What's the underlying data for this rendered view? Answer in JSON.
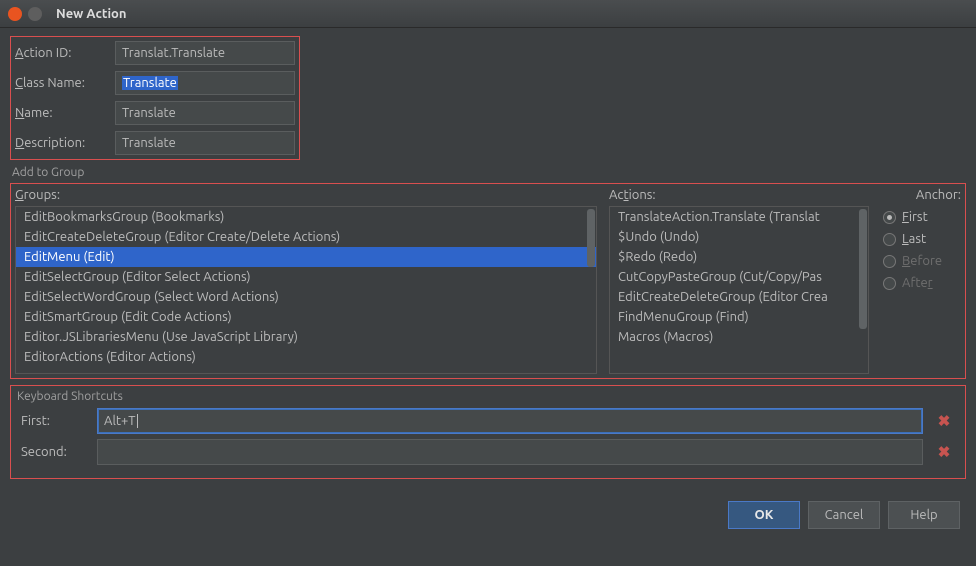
{
  "window": {
    "title": "New Action"
  },
  "form": {
    "action_id": {
      "label_pre": "A",
      "label_post": "ction ID:",
      "value": "Translat.Translate"
    },
    "class_name": {
      "label_pre": "C",
      "label_post": "lass Name:",
      "value": "Translate"
    },
    "name": {
      "label_pre": "N",
      "label_post": "ame:",
      "value": "Translate"
    },
    "description": {
      "label_pre": "D",
      "label_post": "escription:",
      "value": "Translate"
    }
  },
  "add_to_group_label": "Add to Group",
  "groups": {
    "label_pre": "G",
    "label_post": "roups:",
    "items": [
      "EditBookmarksGroup (Bookmarks)",
      "EditCreateDeleteGroup (Editor Create/Delete Actions)",
      "EditMenu (Edit)",
      "EditSelectGroup (Editor Select Actions)",
      "EditSelectWordGroup (Select Word Actions)",
      "EditSmartGroup (Edit Code Actions)",
      "Editor.JSLibrariesMenu (Use JavaScript Library)",
      "EditorActions (Editor Actions)"
    ],
    "selected_index": 2
  },
  "actions": {
    "label_pre": "Ac",
    "label_ul": "t",
    "label_post": "ions:",
    "items": [
      "TranslateAction.Translate (Translat",
      "$Undo (Undo)",
      "$Redo (Redo)",
      "CutCopyPasteGroup (Cut/Copy/Pas",
      "EditCreateDeleteGroup (Editor Crea",
      "FindMenuGroup (Find)",
      "Macros (Macros)"
    ]
  },
  "anchor": {
    "label": "Anchor:",
    "options": [
      {
        "ul": "F",
        "rest": "irst",
        "checked": true,
        "disabled": false
      },
      {
        "ul": "L",
        "rest": "ast",
        "checked": false,
        "disabled": false
      },
      {
        "ul": "B",
        "rest": "efore",
        "checked": false,
        "disabled": true
      },
      {
        "ul": "",
        "rest": "After",
        "checked": false,
        "disabled": true,
        "ul_mid": "r",
        "pre": "Afte"
      }
    ]
  },
  "keyboard": {
    "legend": "Keyboard Shortcuts",
    "first": {
      "label": "First:",
      "value": "Alt+T"
    },
    "second": {
      "label": "Second:",
      "value": ""
    }
  },
  "buttons": {
    "ok": "OK",
    "cancel": "Cancel",
    "help": "Help"
  }
}
